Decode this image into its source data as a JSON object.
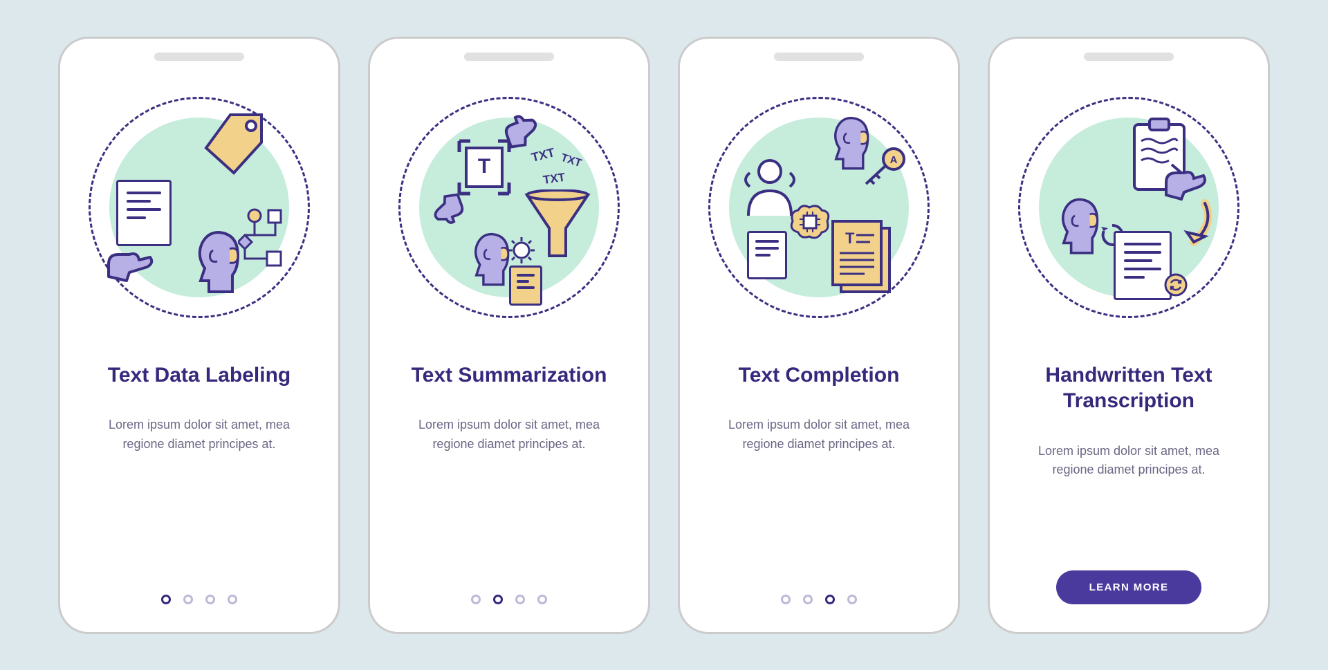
{
  "common": {
    "description": "Lorem ipsum dolor sit amet, mea regione diamet principes at.",
    "learn_more_label": "LEARN MORE"
  },
  "screens": [
    {
      "title": "Text Data Labeling",
      "icon": "text-data-labeling-icon",
      "active_dot_index": 0,
      "has_button": false,
      "dot_count": 4
    },
    {
      "title": "Text Summarization",
      "icon": "text-summarization-icon",
      "active_dot_index": 1,
      "has_button": false,
      "dot_count": 4
    },
    {
      "title": "Text Completion",
      "icon": "text-completion-icon",
      "active_dot_index": 2,
      "has_button": false,
      "dot_count": 4
    },
    {
      "title": "Handwritten Text Transcription",
      "icon": "handwritten-transcription-icon",
      "active_dot_index": 3,
      "has_button": true,
      "dot_count": 4
    }
  ],
  "colors": {
    "accent": "#4a3a9e",
    "title": "#35297c",
    "body": "#6a6684",
    "mint": "#c6ecdc",
    "yellow": "#f2d28a",
    "lilac": "#b6b0e6",
    "background": "#dde8ed"
  }
}
